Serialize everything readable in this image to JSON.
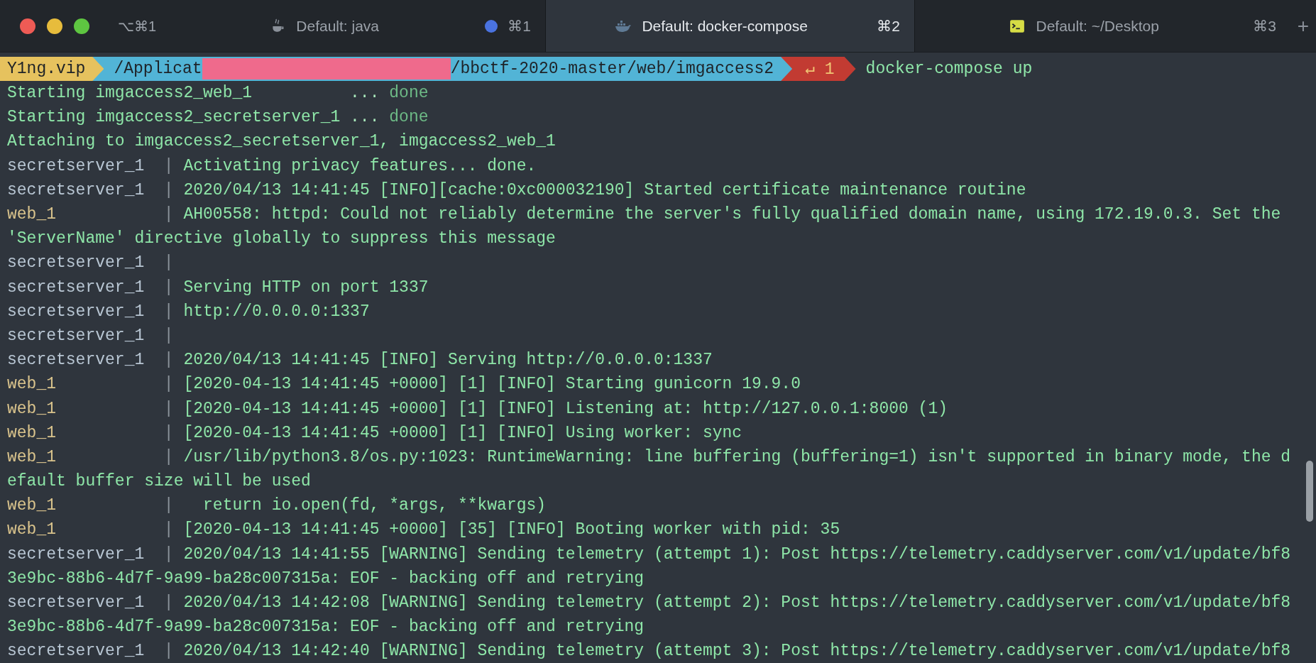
{
  "window": {
    "shortcut": "⌥⌘1"
  },
  "tabs": [
    {
      "label": "Default: java",
      "kind": "java",
      "shortcut": "⌘1",
      "activity": true,
      "selected": false
    },
    {
      "label": "Default: docker-compose",
      "kind": "whale",
      "shortcut": "⌘2",
      "activity": false,
      "selected": true
    },
    {
      "label": "Default: ~/Desktop",
      "kind": "terminal",
      "shortcut": "⌘3",
      "activity": false,
      "selected": false
    }
  ],
  "new_tab": "+",
  "prompt": {
    "host": "Y1ng.vip",
    "path_start": "/Applicat",
    "path_end": "/bbctf-2020-master/web/imgaccess2",
    "exit_status": "↵ 1",
    "command": "docker-compose up"
  },
  "lines": [
    {
      "kind": "starting",
      "text": "Starting imgaccess2_web_1",
      "dots": "...",
      "status": "done"
    },
    {
      "kind": "starting",
      "text": "Starting imgaccess2_secretserver_1",
      "dots": "...",
      "status": "done"
    },
    {
      "kind": "plain",
      "text": "Attaching to imgaccess2_secretserver_1, imgaccess2_web_1"
    },
    {
      "kind": "secret",
      "service": "secretserver_1",
      "sep": "|",
      "message": "Activating privacy features... done."
    },
    {
      "kind": "secret",
      "service": "secretserver_1",
      "sep": "|",
      "message": "2020/04/13 14:41:45 [INFO][cache:0xc000032190] Started certificate maintenance routine"
    },
    {
      "kind": "web",
      "service": "web_1",
      "sep": "|",
      "message": "AH00558: httpd: Could not reliably determine the server's fully qualified domain name, using 172.19.0.3. Set the"
    },
    {
      "kind": "plain",
      "text": "'ServerName' directive globally to suppress this message"
    },
    {
      "kind": "secret",
      "service": "secretserver_1",
      "sep": "|"
    },
    {
      "kind": "secret",
      "service": "secretserver_1",
      "sep": "|",
      "message": "Serving HTTP on port 1337"
    },
    {
      "kind": "secret",
      "service": "secretserver_1",
      "sep": "|",
      "message": "http://0.0.0.0:1337"
    },
    {
      "kind": "secret",
      "service": "secretserver_1",
      "sep": "|"
    },
    {
      "kind": "secret",
      "service": "secretserver_1",
      "sep": "|",
      "message": "2020/04/13 14:41:45 [INFO] Serving http://0.0.0.0:1337"
    },
    {
      "kind": "web",
      "service": "web_1",
      "sep": "|",
      "message": "[2020-04-13 14:41:45 +0000] [1] [INFO] Starting gunicorn 19.9.0"
    },
    {
      "kind": "web",
      "service": "web_1",
      "sep": "|",
      "message": "[2020-04-13 14:41:45 +0000] [1] [INFO] Listening at: http://127.0.0.1:8000 (1)"
    },
    {
      "kind": "web",
      "service": "web_1",
      "sep": "|",
      "message": "[2020-04-13 14:41:45 +0000] [1] [INFO] Using worker: sync"
    },
    {
      "kind": "web",
      "service": "web_1",
      "sep": "|",
      "message": "/usr/lib/python3.8/os.py:1023: RuntimeWarning: line buffering (buffering=1) isn't supported in binary mode, the d"
    },
    {
      "kind": "plain",
      "text": "efault buffer size will be used"
    },
    {
      "kind": "web",
      "service": "web_1",
      "sep": "|",
      "message": "  return io.open(fd, *args, **kwargs)"
    },
    {
      "kind": "web",
      "service": "web_1",
      "sep": "|",
      "message": "[2020-04-13 14:41:45 +0000] [35] [INFO] Booting worker with pid: 35"
    },
    {
      "kind": "secret",
      "service": "secretserver_1",
      "sep": "|",
      "message": "2020/04/13 14:41:55 [WARNING] Sending telemetry (attempt 1): Post https://telemetry.caddyserver.com/v1/update/bf8"
    },
    {
      "kind": "plain",
      "text": "3e9bc-88b6-4d7f-9a99-ba28c007315a: EOF - backing off and retrying"
    },
    {
      "kind": "secret",
      "service": "secretserver_1",
      "sep": "|",
      "message": "2020/04/13 14:42:08 [WARNING] Sending telemetry (attempt 2): Post https://telemetry.caddyserver.com/v1/update/bf8"
    },
    {
      "kind": "plain",
      "text": "3e9bc-88b6-4d7f-9a99-ba28c007315a: EOF - backing off and retrying"
    },
    {
      "kind": "secret",
      "service": "secretserver_1",
      "sep": "|",
      "message": "2020/04/13 14:42:40 [WARNING] Sending telemetry (attempt 3): Post https://telemetry.caddyserver.com/v1/update/bf8"
    }
  ]
}
